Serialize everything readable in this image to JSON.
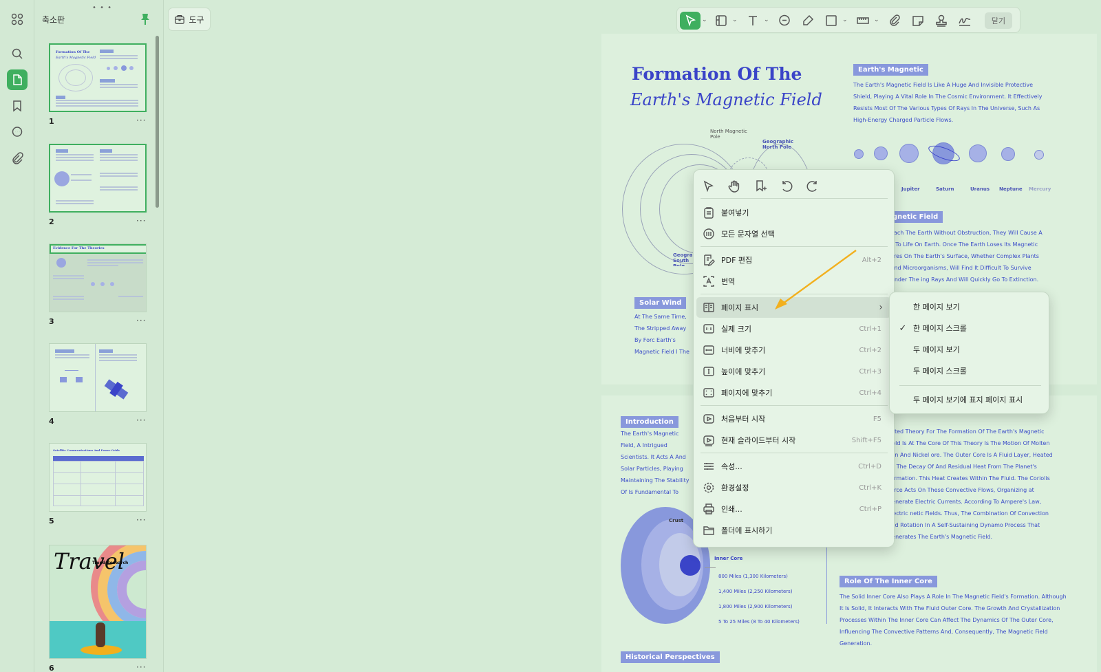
{
  "sidebar": {
    "title": "축소판",
    "thumbnails": [
      {
        "num": "1",
        "caption_line1": "Formation Of The",
        "caption_line2": "Earth's Magnetic Field"
      },
      {
        "num": "2"
      },
      {
        "num": "3",
        "caption_line1": "Evidence For The Theories"
      },
      {
        "num": "4"
      },
      {
        "num": "5",
        "caption_line1": "Satellite Communications And Power Grids"
      },
      {
        "num": "6",
        "caption_line1": "Travel",
        "caption_line2": "Trend Research"
      }
    ],
    "more": "···"
  },
  "topbar": {
    "tools_label": "도구",
    "close_label": "닫기"
  },
  "document": {
    "title_line1": "Formation Of The",
    "title_line2": "Earth's Magnetic Field",
    "tag_magnetic": "Earth's Magnetic",
    "para_magnetic": "The Earth's Magnetic Field Is Like A Huge And Invisible Protective Shield, Playing A Vital Role In The Cosmic Environment. It Effectively Resists Most Of The Various Types Of Rays In The Universe, Such As High-Energy Charged Particle Flows.",
    "planets": [
      "Jupiter",
      "Saturn",
      "Uranus",
      "Neptune",
      "Mercury"
    ],
    "label_north_mag": "North Magnetic Pole",
    "label_geo_north": "Geographic North Pole",
    "label_geo_south": "Geographic South Pole",
    "tag_field": "gnetic Field",
    "para_field": "each The Earth Without Obstruction, They Will Cause A y To Life On Earth. Once The Earth Loses Its Magnetic ures On The Earth's Surface, Whether Complex Plants And Microorganisms, Will Find It Difficult To Survive Under The ing Rays And Will Quickly Go To Extinction.",
    "tag_solar": "Solar Wind",
    "para_solar": "At The Same Time, The Stripped Away By Forc Earth's Magnetic Field I The Stable Existence O",
    "tag_intro": "Introduction",
    "para_intro": "The Earth's Magnetic Field, A Intrigued Scientists. It Acts A And Solar Particles, Playing Maintaining The Stability Of Is Fundamental To Various S Astrobiology.",
    "para_theory": "epted Theory For The Formation Of The Earth's Magnetic Field Is At The Core Of This Theory Is The Motion Of Molten Iron And Nickel ore. The Outer Core Is A Fluid Layer, Heated By The Decay Of And Residual Heat From The Planet's Formation. This Heat Creates Within The Fluid. The Coriolis Force Acts On These Convective Flows, Organizing at Generate Electric Currents. According To Ampere's Law, Electric netic Fields. Thus, The Combination Of Convection And Rotation In A Self-Sustaining Dynamo Process That Generates The Earth's Magnetic Field.",
    "tag_inner": "Role Of The Inner Core",
    "para_inner": "The Solid Inner Core Also Plays A Role In The Magnetic Field's Formation. Although It Is Solid, It Interacts With The Fluid Outer Core. The Growth And Crystallization Processes Within The Inner Core Can Affect The Dynamics Of The Outer Core, Influencing The Convective Patterns And, Consequently, The Magnetic Field Generation.",
    "label_crust": "Crust",
    "label_inner_core": "Inner Core",
    "depths": [
      "800 Miles (1,300 Kilometers)",
      "1,400 Miles (2,250 Kilometers)",
      "1,800 Miles (2,900 Kilometers)",
      "5 To 25 Miles (8 To 40 Kilometers)"
    ],
    "tag_hist": "Historical Perspectives"
  },
  "context_menu": {
    "tools": [
      "select-tool",
      "hand-tool",
      "add-page-tool",
      "rotate-left-tool",
      "rotate-right-tool"
    ],
    "items": [
      {
        "label": "붙여넣기",
        "shortcut": ""
      },
      {
        "label": "모든 문자열 선택",
        "shortcut": ""
      },
      {
        "label": "PDF 편집",
        "shortcut": "Alt+2"
      },
      {
        "label": "번역",
        "shortcut": ""
      },
      {
        "label": "페이지 표시",
        "shortcut": ""
      },
      {
        "label": "실제 크기",
        "shortcut": "Ctrl+1"
      },
      {
        "label": "너비에 맞추기",
        "shortcut": "Ctrl+2"
      },
      {
        "label": "높이에 맞추기",
        "shortcut": "Ctrl+3"
      },
      {
        "label": "페이지에 맞추기",
        "shortcut": "Ctrl+4"
      },
      {
        "label": "처음부터 시작",
        "shortcut": "F5"
      },
      {
        "label": "현재 슬라이드부터 시작",
        "shortcut": "Shift+F5"
      },
      {
        "label": "속성...",
        "shortcut": "Ctrl+D"
      },
      {
        "label": "환경설정",
        "shortcut": "Ctrl+K"
      },
      {
        "label": "인쇄...",
        "shortcut": "Ctrl+P"
      },
      {
        "label": "폴더에 표시하기",
        "shortcut": ""
      }
    ]
  },
  "submenu": {
    "items": [
      {
        "label": "한 페이지 보기",
        "checked": ""
      },
      {
        "label": "한 페이지 스크롤",
        "checked": "✓"
      },
      {
        "label": "두 페이지 보기",
        "checked": ""
      },
      {
        "label": "두 페이지 스크롤",
        "checked": ""
      },
      {
        "label": "두 페이지 보기에 표지 페이지 표시",
        "checked": ""
      }
    ]
  },
  "colors": {
    "accent": "#3faf5f",
    "doc_blue": "#3a44c8",
    "arrow": "#f2b01e"
  }
}
